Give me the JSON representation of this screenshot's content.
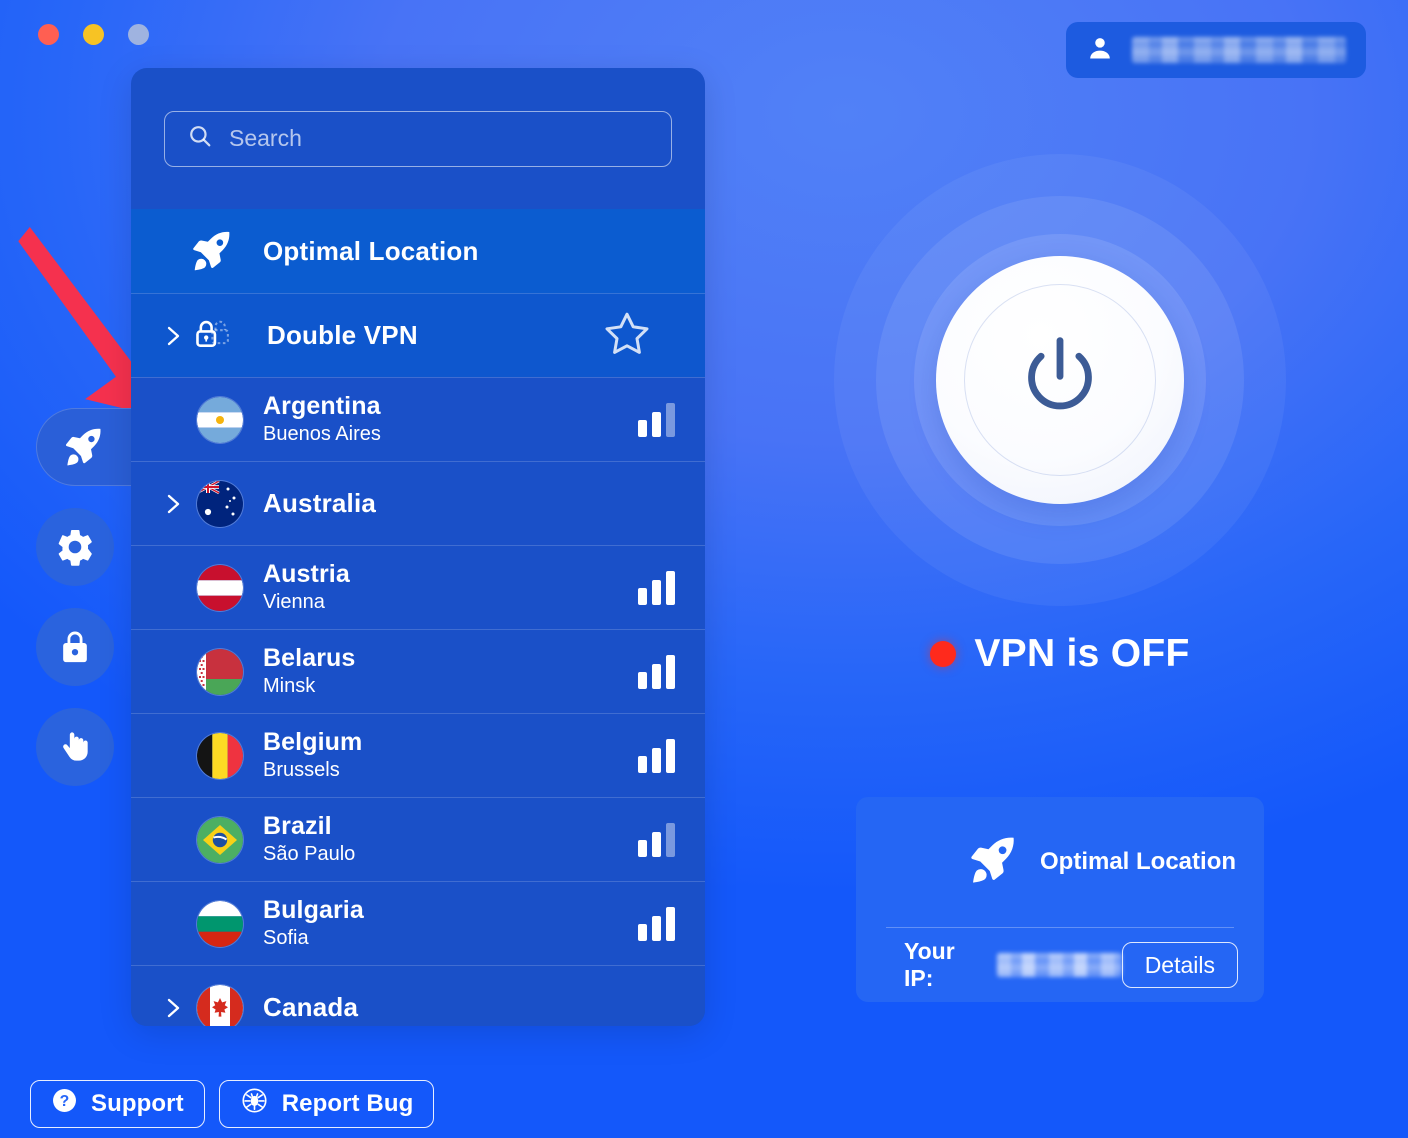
{
  "window": {
    "controls": [
      {
        "name": "close",
        "color": "#FF5F52"
      },
      {
        "name": "minimize",
        "color": "#F7C324"
      },
      {
        "name": "zoom",
        "color": "#9FB3E0"
      }
    ]
  },
  "account": {
    "icon": "user-icon",
    "username_redacted": "[blurred]"
  },
  "sidebar": {
    "items": [
      {
        "id": "locations",
        "icon": "rocket-icon",
        "active": true
      },
      {
        "id": "settings",
        "icon": "gear-icon",
        "active": false
      },
      {
        "id": "security",
        "icon": "lock-icon",
        "active": false
      },
      {
        "id": "blocker",
        "icon": "hand-icon",
        "active": false
      }
    ]
  },
  "annotation": {
    "type": "arrow",
    "color": "#F5314E",
    "points_to": "sidebar-item-locations"
  },
  "search": {
    "icon": "search-icon",
    "value": "",
    "placeholder": "Search"
  },
  "locations": {
    "special": [
      {
        "id": "optimal-location",
        "label": "Optimal Location",
        "icon": "rocket-icon",
        "selected": true,
        "expandable": false
      },
      {
        "id": "double-vpn",
        "label": "Double VPN",
        "icon": "double-lock-icon",
        "selected": false,
        "expandable": true,
        "favorite_icon": "star-outline-icon"
      }
    ],
    "countries": [
      {
        "name": "Argentina",
        "city": "Buenos Aires",
        "flag": "ar",
        "expandable": false,
        "signal": 2
      },
      {
        "name": "Australia",
        "city": "",
        "flag": "au",
        "expandable": true,
        "signal": null
      },
      {
        "name": "Austria",
        "city": "Vienna",
        "flag": "at",
        "expandable": false,
        "signal": 3
      },
      {
        "name": "Belarus",
        "city": "Minsk",
        "flag": "by",
        "expandable": false,
        "signal": 3
      },
      {
        "name": "Belgium",
        "city": "Brussels",
        "flag": "be",
        "expandable": false,
        "signal": 3
      },
      {
        "name": "Brazil",
        "city": "São Paulo",
        "flag": "br",
        "expandable": false,
        "signal": 2
      },
      {
        "name": "Bulgaria",
        "city": "Sofia",
        "flag": "bg",
        "expandable": false,
        "signal": 3
      },
      {
        "name": "Canada",
        "city": "",
        "flag": "ca",
        "expandable": true,
        "signal": null
      }
    ]
  },
  "connection": {
    "power_icon": "power-icon",
    "status_text": "VPN is OFF",
    "status_color": "#FF2A1C",
    "connected": false
  },
  "info_card": {
    "location_icon": "rocket-icon",
    "location_label": "Optimal Location",
    "ip_label": "Your IP:",
    "ip_value_redacted": "[blurred]",
    "details_label": "Details"
  },
  "footer": {
    "support": {
      "label": "Support",
      "icon": "question-circle-icon"
    },
    "report_bug": {
      "label": "Report Bug",
      "icon": "bug-icon"
    }
  },
  "theme": {
    "bg_top": "#5181F7",
    "bg_bottom": "#1458FA",
    "panel": "#1A50C8",
    "panel_selected": "#0B5CD0",
    "accent": "#2566F4",
    "danger": "#FF2A1C",
    "annotation": "#F5314E"
  }
}
